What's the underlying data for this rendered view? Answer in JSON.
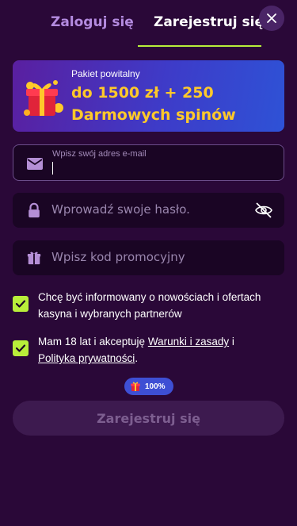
{
  "tabs": {
    "login": "Zaloguj się",
    "register": "Zarejestruj się",
    "active": "register"
  },
  "close": {
    "icon": "close-icon"
  },
  "promo": {
    "small": "Pakiet powitalny",
    "line1": "do 1500 zł + 250",
    "line2": "Darmowych spinów",
    "icon": "gift-icon"
  },
  "email": {
    "label": "Wpisz swój adres e-mail",
    "value": "",
    "icon": "envelope-icon"
  },
  "password": {
    "placeholder": "Wprowadź swoje hasło.",
    "icon": "lock-icon",
    "toggle_icon": "eye-off-icon"
  },
  "promo_code": {
    "placeholder": "Wpisz kod promocyjny",
    "icon": "gift-icon"
  },
  "consents": {
    "marketing": {
      "checked": true,
      "text": "Chcę być informowany o nowościach i ofertach kasyna i wybranych partnerów"
    },
    "terms": {
      "checked": true,
      "text_before": "Mam 18 lat i akceptuję ",
      "terms_link": "Warunki i zasady",
      "text_middle": " i ",
      "privacy_link": "Polityka prywatności",
      "text_after": "."
    }
  },
  "progress": {
    "label": "100%",
    "value": 1.0,
    "icon": "gift-icon"
  },
  "submit": {
    "label": "Zarejestruj się",
    "enabled": false
  },
  "colors": {
    "background": "#2a0838",
    "accent": "#b8ee3a",
    "promo_text": "#ffc92a",
    "tab_inactive": "#b48be0"
  }
}
